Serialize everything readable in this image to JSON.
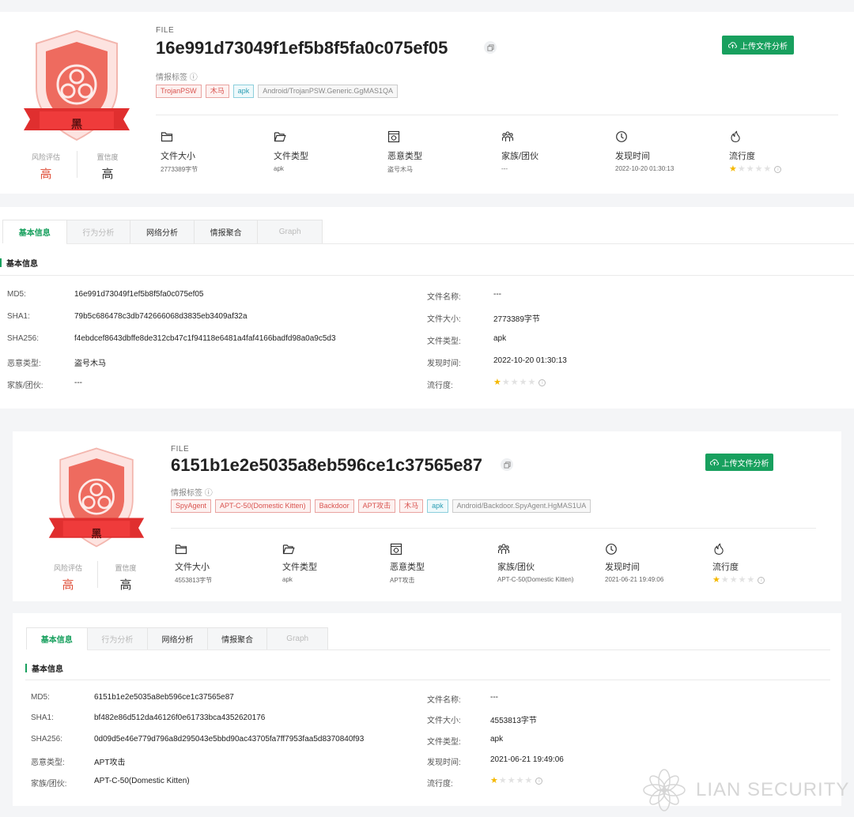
{
  "reports": [
    {
      "file_label": "FILE",
      "hash": "16e991d73049f1ef5b8f5fa0c075ef05",
      "tag_label": "情报标签",
      "tags": [
        {
          "text": "TrojanPSW",
          "style": "red"
        },
        {
          "text": "木马",
          "style": "red"
        },
        {
          "text": "apk",
          "style": "teal"
        },
        {
          "text": "Android/TrojanPSW.Generic.GgMAS1QA",
          "style": "gray"
        }
      ],
      "upload_label": "上传文件分析",
      "badge_text": "黑",
      "risk": {
        "label": "风险评估",
        "value": "高"
      },
      "confidence": {
        "label": "置信度",
        "value": "高"
      },
      "stats": {
        "size": {
          "title": "文件大小",
          "value": "2773389字节"
        },
        "type": {
          "title": "文件类型",
          "value": "apk"
        },
        "malware": {
          "title": "恶意类型",
          "value": "盗号木马"
        },
        "family": {
          "title": "家族/团伙",
          "value": "---"
        },
        "time": {
          "title": "发现时间",
          "value": "2022-10-20 01:30:13"
        },
        "popularity": {
          "title": "流行度",
          "stars": 1,
          "max": 5
        }
      },
      "tabs": [
        {
          "label": "基本信息",
          "state": "active"
        },
        {
          "label": "行为分析",
          "state": "disabled"
        },
        {
          "label": "网络分析",
          "state": "normal"
        },
        {
          "label": "情报聚合",
          "state": "normal"
        },
        {
          "label": "Graph",
          "state": "disabled"
        }
      ],
      "section_title": "基本信息",
      "left_kv": [
        {
          "k": "MD5:",
          "v": "16e991d73049f1ef5b8f5fa0c075ef05"
        },
        {
          "k": "SHA1:",
          "v": "79b5c686478c3db742666068d3835eb3409af32a"
        },
        {
          "k": "SHA256:",
          "v": "f4ebdcef8643dbffe8de312cb47c1f94118e6481a4faf4166badfd98a0a9c5d3"
        },
        {
          "k": "恶意类型:",
          "v": "盗号木马"
        },
        {
          "k": "家族/团伙:",
          "v": "---"
        }
      ],
      "right_kv": [
        {
          "k": "文件名称:",
          "v": "---"
        },
        {
          "k": "文件大小:",
          "v": "2773389字节"
        },
        {
          "k": "文件类型:",
          "v": "apk"
        },
        {
          "k": "发现时间:",
          "v": "2022-10-20 01:30:13"
        },
        {
          "k": "流行度:",
          "v": ""
        }
      ]
    },
    {
      "file_label": "FILE",
      "hash": "6151b1e2e5035a8eb596ce1c37565e87",
      "tag_label": "情报标签",
      "tags": [
        {
          "text": "SpyAgent",
          "style": "red"
        },
        {
          "text": "APT-C-50(Domestic Kitten)",
          "style": "red"
        },
        {
          "text": "Backdoor",
          "style": "red"
        },
        {
          "text": "APT攻击",
          "style": "red"
        },
        {
          "text": "木马",
          "style": "red"
        },
        {
          "text": "apk",
          "style": "teal"
        },
        {
          "text": "Android/Backdoor.SpyAgent.HgMAS1UA",
          "style": "gray"
        }
      ],
      "upload_label": "上传文件分析",
      "badge_text": "黑",
      "risk": {
        "label": "风险评估",
        "value": "高"
      },
      "confidence": {
        "label": "置信度",
        "value": "高"
      },
      "stats": {
        "size": {
          "title": "文件大小",
          "value": "4553813字节"
        },
        "type": {
          "title": "文件类型",
          "value": "apk"
        },
        "malware": {
          "title": "恶意类型",
          "value": "APT攻击"
        },
        "family": {
          "title": "家族/团伙",
          "value": "APT-C-50(Domestic Kitten)"
        },
        "time": {
          "title": "发现时间",
          "value": "2021-06-21 19:49:06"
        },
        "popularity": {
          "title": "流行度",
          "stars": 1,
          "max": 5
        }
      },
      "tabs": [
        {
          "label": "基本信息",
          "state": "active"
        },
        {
          "label": "行为分析",
          "state": "disabled"
        },
        {
          "label": "网络分析",
          "state": "normal"
        },
        {
          "label": "情报聚合",
          "state": "normal"
        },
        {
          "label": "Graph",
          "state": "disabled"
        }
      ],
      "section_title": "基本信息",
      "left_kv": [
        {
          "k": "MD5:",
          "v": "6151b1e2e5035a8eb596ce1c37565e87"
        },
        {
          "k": "SHA1:",
          "v": "bf482e86d512da46126f0e61733bca4352620176"
        },
        {
          "k": "SHA256:",
          "v": "0d09d5e46e779d796a8d295043e5bbd90ac43705fa7ff7953faa5d8370840f93"
        },
        {
          "k": "恶意类型:",
          "v": "APT攻击"
        },
        {
          "k": "家族/团伙:",
          "v": "APT-C-50(Domestic Kitten)"
        }
      ],
      "right_kv": [
        {
          "k": "文件名称:",
          "v": "---"
        },
        {
          "k": "文件大小:",
          "v": "4553813字节"
        },
        {
          "k": "文件类型:",
          "v": "apk"
        },
        {
          "k": "发现时间:",
          "v": "2021-06-21 19:49:06"
        },
        {
          "k": "流行度:",
          "v": ""
        }
      ]
    }
  ],
  "watermark": "LIAN SECURITY",
  "colors": {
    "accent": "#18a05e",
    "danger": "#e0533d",
    "star": "#f5b800"
  }
}
